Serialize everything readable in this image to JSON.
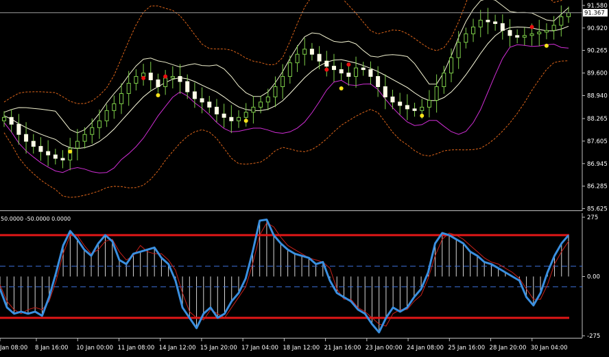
{
  "chart_data": [
    {
      "type": "candlestick",
      "title": "",
      "price_axis": {
        "ticks": [
          "91.580",
          "90.920",
          "90.265",
          "89.600",
          "88.940",
          "88.265",
          "87.605",
          "86.945",
          "86.285",
          "85.625"
        ],
        "tick_values": [
          91.58,
          90.92,
          90.265,
          89.6,
          88.94,
          88.265,
          87.605,
          86.945,
          86.285,
          85.625
        ],
        "range": [
          85.625,
          91.58
        ],
        "current_price_label": "91.367",
        "current_price": 91.367
      },
      "time_axis": {
        "labels": [
          "Jan 08:00",
          "8 Jan 16:00",
          "10 Jan 00:00",
          "11 Jan 08:00",
          "14 Jan 12:00",
          "15 Jan 20:00",
          "17 Jan 04:00",
          "18 Jan 12:00",
          "21 Jan 16:00",
          "23 Jan 00:00",
          "24 Jan 08:00",
          "25 Jan 16:00",
          "28 Jan 20:00",
          "30 Jan 04:00"
        ]
      },
      "closes": [
        88.3,
        88.1,
        87.8,
        87.6,
        87.45,
        87.3,
        87.2,
        87.1,
        87.05,
        87.4,
        87.6,
        87.8,
        88.0,
        88.2,
        88.5,
        88.7,
        89.0,
        89.3,
        89.5,
        89.6,
        89.4,
        89.2,
        89.45,
        89.5,
        89.35,
        89.05,
        88.85,
        88.75,
        88.6,
        88.4,
        88.3,
        88.2,
        88.3,
        88.45,
        88.6,
        88.75,
        88.9,
        89.2,
        89.5,
        89.9,
        90.15,
        90.3,
        90.15,
        89.95,
        89.8,
        89.7,
        89.6,
        89.5,
        89.75,
        89.7,
        89.5,
        89.2,
        88.9,
        88.75,
        88.65,
        88.55,
        88.5,
        88.6,
        88.8,
        89.2,
        89.6,
        90.05,
        90.5,
        90.75,
        90.95,
        91.15,
        91.1,
        91.05,
        90.85,
        90.7,
        90.65,
        90.7,
        90.75,
        90.8,
        90.85,
        91.0,
        91.25,
        91.367
      ],
      "bollinger_period_label": "",
      "signal_dots": {
        "red": [
          [
            19,
            89.45
          ],
          [
            22,
            89.5
          ],
          [
            44,
            89.7
          ],
          [
            47,
            89.85
          ],
          [
            72,
            90.95
          ]
        ],
        "yellow": [
          [
            9,
            87.3
          ],
          [
            21,
            88.95
          ],
          [
            33,
            88.2
          ],
          [
            46,
            89.15
          ],
          [
            57,
            88.35
          ],
          [
            74,
            90.4
          ]
        ]
      }
    },
    {
      "type": "oscillator",
      "header": "50.0000 -50.0000 0.0000",
      "y_ticks": [
        "275",
        "0.00",
        "-275"
      ],
      "y_tick_values": [
        275,
        0,
        -275
      ],
      "range": [
        -290,
        290
      ],
      "levels": {
        "upper": 200,
        "lower": -200,
        "dashed_upper": 50,
        "dashed_lower": -50
      },
      "series": [
        {
          "name": "",
          "color": "#3A8FE0",
          "values": [
            -60,
            -150,
            -180,
            -170,
            -180,
            -170,
            -190,
            -100,
            20,
            150,
            220,
            180,
            130,
            100,
            160,
            200,
            170,
            80,
            60,
            110,
            120,
            130,
            140,
            90,
            60,
            -20,
            -150,
            -200,
            -250,
            -180,
            -150,
            -200,
            -180,
            -120,
            -80,
            -10,
            120,
            270,
            275,
            200,
            160,
            130,
            110,
            100,
            90,
            60,
            70,
            -20,
            -80,
            -100,
            -120,
            -160,
            -180,
            -230,
            -270,
            -200,
            -150,
            -170,
            -150,
            -100,
            -60,
            20,
            160,
            210,
            200,
            180,
            160,
            120,
            100,
            70,
            60,
            40,
            20,
            0,
            -20,
            -100,
            -140,
            -80,
            20,
            100,
            160,
            200
          ]
        },
        {
          "name": "",
          "color": "#C8201A",
          "values": [
            -40,
            -120,
            -160,
            -180,
            -160,
            -150,
            -160,
            -120,
            -20,
            110,
            200,
            200,
            150,
            110,
            130,
            170,
            180,
            120,
            80,
            100,
            150,
            120,
            110,
            110,
            80,
            30,
            -80,
            -170,
            -200,
            -210,
            -160,
            -180,
            -200,
            -150,
            -100,
            -50,
            60,
            200,
            260,
            240,
            190,
            150,
            130,
            110,
            90,
            80,
            70,
            40,
            -60,
            -110,
            -110,
            -150,
            -170,
            -200,
            -230,
            -240,
            -180,
            -160,
            -160,
            -120,
            -90,
            -10,
            100,
            180,
            210,
            200,
            180,
            150,
            120,
            90,
            70,
            60,
            40,
            20,
            -10,
            -60,
            -110,
            -110,
            -40,
            60,
            120,
            170
          ]
        }
      ]
    }
  ]
}
